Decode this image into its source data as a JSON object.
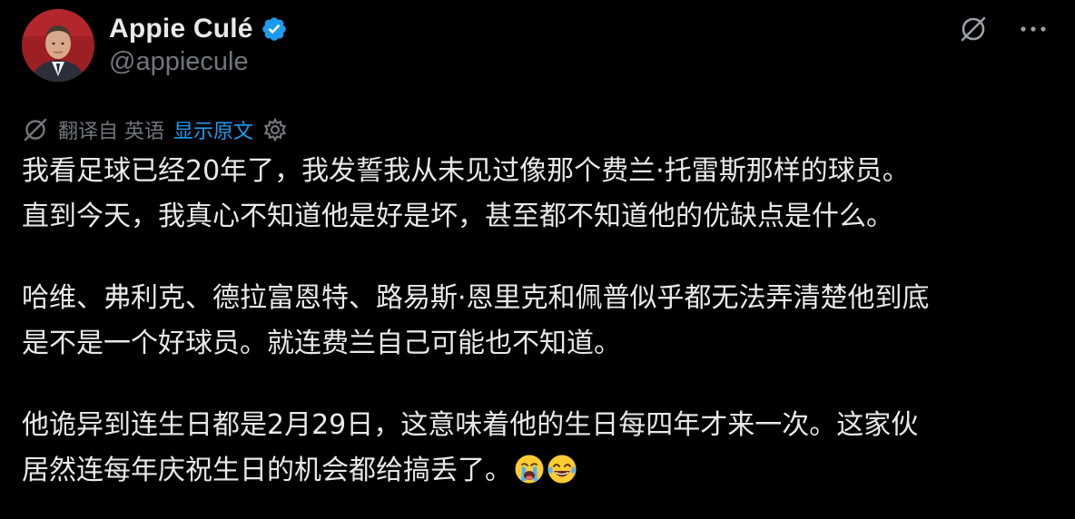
{
  "author": {
    "display_name": "Appie Culé",
    "handle": "@appiecule",
    "verified": true,
    "verified_color": "#1d9bf0"
  },
  "translation": {
    "label": "翻译自 英语",
    "show_original": "显示原文"
  },
  "tweet": {
    "para1_line1": "我看足球已经20年了，我发誓我从未见过像那个费兰·托雷斯那样的球员。",
    "para1_line2": "直到今天，我真心不知道他是好是坏，甚至都不知道他的优缺点是什么。",
    "para2_line1": "哈维、弗利克、德拉富恩特、路易斯·恩里克和佩普似乎都无法弄清楚他到底",
    "para2_line2": "是不是一个好球员。就连费兰自己可能也不知道。",
    "para3_line1": "他诡异到连生日都是2月29日，这意味着他的生日每四年才来一次。这家伙",
    "para3_line2": "居然连每年庆祝生日的机会都给搞丢了。",
    "emojis": [
      "loudly-crying-face",
      "face-with-tears-of-joy"
    ]
  },
  "colors": {
    "background": "#000000",
    "text_primary": "#e7e9ea",
    "text_secondary": "#71767b",
    "link": "#1d9bf0"
  },
  "icons": {
    "grok": "grok-icon",
    "more": "more-icon",
    "translate": "translate-icon",
    "settings": "gear-icon"
  }
}
